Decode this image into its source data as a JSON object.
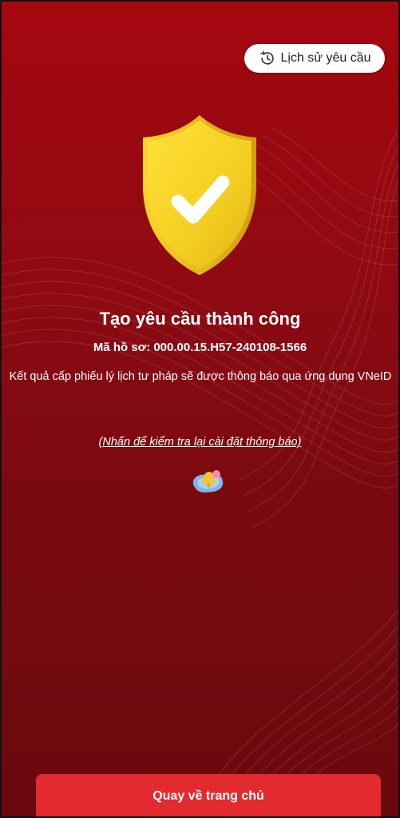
{
  "header": {
    "history_button": {
      "label": "Lịch sử yêu cầu",
      "icon": "clock-history-icon"
    }
  },
  "result": {
    "icon": "shield-check-icon",
    "title": "Tạo yêu cầu thành công",
    "code_label": "Mã hồ sơ:",
    "code_value": "000.00.15.H57-240108-1566",
    "description": "Kết quả cấp phiếu lý lịch tư pháp sẽ được thông báo qua ứng dụng VNeID",
    "check_settings_link": "(Nhấn để kiểm tra lại cài đặt thông báo)",
    "notification_icon": "bell-notification-icon"
  },
  "footer": {
    "home_button": {
      "label": "Quay về trang chủ"
    }
  },
  "colors": {
    "background_top": "#a6070f",
    "background_bottom": "#6a090e",
    "shield": "#f4cf22",
    "primary_button": "#e22a2f"
  }
}
